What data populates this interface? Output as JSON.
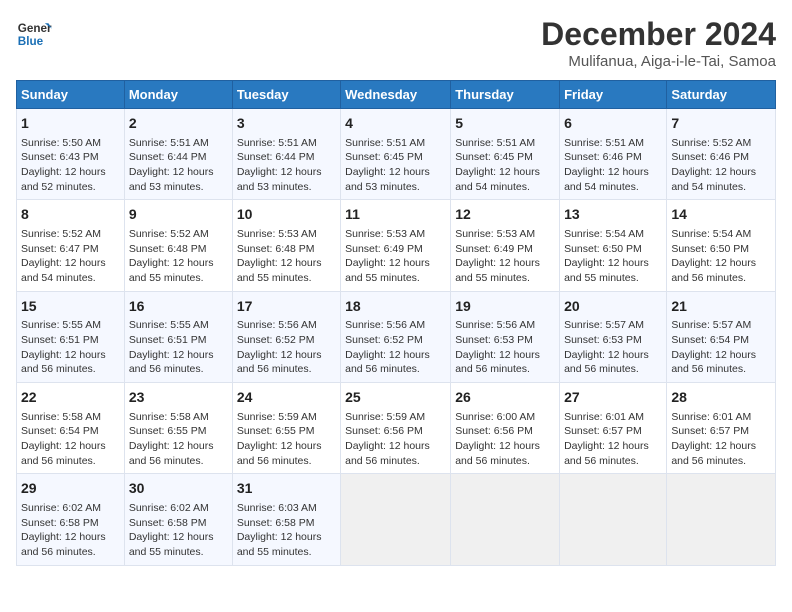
{
  "logo": {
    "line1": "General",
    "line2": "Blue"
  },
  "title": "December 2024",
  "location": "Mulifanua, Aiga-i-le-Tai, Samoa",
  "days_header": [
    "Sunday",
    "Monday",
    "Tuesday",
    "Wednesday",
    "Thursday",
    "Friday",
    "Saturday"
  ],
  "weeks": [
    [
      {
        "day": "1",
        "sunrise": "Sunrise: 5:50 AM",
        "sunset": "Sunset: 6:43 PM",
        "daylight": "Daylight: 12 hours and 52 minutes."
      },
      {
        "day": "2",
        "sunrise": "Sunrise: 5:51 AM",
        "sunset": "Sunset: 6:44 PM",
        "daylight": "Daylight: 12 hours and 53 minutes."
      },
      {
        "day": "3",
        "sunrise": "Sunrise: 5:51 AM",
        "sunset": "Sunset: 6:44 PM",
        "daylight": "Daylight: 12 hours and 53 minutes."
      },
      {
        "day": "4",
        "sunrise": "Sunrise: 5:51 AM",
        "sunset": "Sunset: 6:45 PM",
        "daylight": "Daylight: 12 hours and 53 minutes."
      },
      {
        "day": "5",
        "sunrise": "Sunrise: 5:51 AM",
        "sunset": "Sunset: 6:45 PM",
        "daylight": "Daylight: 12 hours and 54 minutes."
      },
      {
        "day": "6",
        "sunrise": "Sunrise: 5:51 AM",
        "sunset": "Sunset: 6:46 PM",
        "daylight": "Daylight: 12 hours and 54 minutes."
      },
      {
        "day": "7",
        "sunrise": "Sunrise: 5:52 AM",
        "sunset": "Sunset: 6:46 PM",
        "daylight": "Daylight: 12 hours and 54 minutes."
      }
    ],
    [
      {
        "day": "8",
        "sunrise": "Sunrise: 5:52 AM",
        "sunset": "Sunset: 6:47 PM",
        "daylight": "Daylight: 12 hours and 54 minutes."
      },
      {
        "day": "9",
        "sunrise": "Sunrise: 5:52 AM",
        "sunset": "Sunset: 6:48 PM",
        "daylight": "Daylight: 12 hours and 55 minutes."
      },
      {
        "day": "10",
        "sunrise": "Sunrise: 5:53 AM",
        "sunset": "Sunset: 6:48 PM",
        "daylight": "Daylight: 12 hours and 55 minutes."
      },
      {
        "day": "11",
        "sunrise": "Sunrise: 5:53 AM",
        "sunset": "Sunset: 6:49 PM",
        "daylight": "Daylight: 12 hours and 55 minutes."
      },
      {
        "day": "12",
        "sunrise": "Sunrise: 5:53 AM",
        "sunset": "Sunset: 6:49 PM",
        "daylight": "Daylight: 12 hours and 55 minutes."
      },
      {
        "day": "13",
        "sunrise": "Sunrise: 5:54 AM",
        "sunset": "Sunset: 6:50 PM",
        "daylight": "Daylight: 12 hours and 55 minutes."
      },
      {
        "day": "14",
        "sunrise": "Sunrise: 5:54 AM",
        "sunset": "Sunset: 6:50 PM",
        "daylight": "Daylight: 12 hours and 56 minutes."
      }
    ],
    [
      {
        "day": "15",
        "sunrise": "Sunrise: 5:55 AM",
        "sunset": "Sunset: 6:51 PM",
        "daylight": "Daylight: 12 hours and 56 minutes."
      },
      {
        "day": "16",
        "sunrise": "Sunrise: 5:55 AM",
        "sunset": "Sunset: 6:51 PM",
        "daylight": "Daylight: 12 hours and 56 minutes."
      },
      {
        "day": "17",
        "sunrise": "Sunrise: 5:56 AM",
        "sunset": "Sunset: 6:52 PM",
        "daylight": "Daylight: 12 hours and 56 minutes."
      },
      {
        "day": "18",
        "sunrise": "Sunrise: 5:56 AM",
        "sunset": "Sunset: 6:52 PM",
        "daylight": "Daylight: 12 hours and 56 minutes."
      },
      {
        "day": "19",
        "sunrise": "Sunrise: 5:56 AM",
        "sunset": "Sunset: 6:53 PM",
        "daylight": "Daylight: 12 hours and 56 minutes."
      },
      {
        "day": "20",
        "sunrise": "Sunrise: 5:57 AM",
        "sunset": "Sunset: 6:53 PM",
        "daylight": "Daylight: 12 hours and 56 minutes."
      },
      {
        "day": "21",
        "sunrise": "Sunrise: 5:57 AM",
        "sunset": "Sunset: 6:54 PM",
        "daylight": "Daylight: 12 hours and 56 minutes."
      }
    ],
    [
      {
        "day": "22",
        "sunrise": "Sunrise: 5:58 AM",
        "sunset": "Sunset: 6:54 PM",
        "daylight": "Daylight: 12 hours and 56 minutes."
      },
      {
        "day": "23",
        "sunrise": "Sunrise: 5:58 AM",
        "sunset": "Sunset: 6:55 PM",
        "daylight": "Daylight: 12 hours and 56 minutes."
      },
      {
        "day": "24",
        "sunrise": "Sunrise: 5:59 AM",
        "sunset": "Sunset: 6:55 PM",
        "daylight": "Daylight: 12 hours and 56 minutes."
      },
      {
        "day": "25",
        "sunrise": "Sunrise: 5:59 AM",
        "sunset": "Sunset: 6:56 PM",
        "daylight": "Daylight: 12 hours and 56 minutes."
      },
      {
        "day": "26",
        "sunrise": "Sunrise: 6:00 AM",
        "sunset": "Sunset: 6:56 PM",
        "daylight": "Daylight: 12 hours and 56 minutes."
      },
      {
        "day": "27",
        "sunrise": "Sunrise: 6:01 AM",
        "sunset": "Sunset: 6:57 PM",
        "daylight": "Daylight: 12 hours and 56 minutes."
      },
      {
        "day": "28",
        "sunrise": "Sunrise: 6:01 AM",
        "sunset": "Sunset: 6:57 PM",
        "daylight": "Daylight: 12 hours and 56 minutes."
      }
    ],
    [
      {
        "day": "29",
        "sunrise": "Sunrise: 6:02 AM",
        "sunset": "Sunset: 6:58 PM",
        "daylight": "Daylight: 12 hours and 56 minutes."
      },
      {
        "day": "30",
        "sunrise": "Sunrise: 6:02 AM",
        "sunset": "Sunset: 6:58 PM",
        "daylight": "Daylight: 12 hours and 55 minutes."
      },
      {
        "day": "31",
        "sunrise": "Sunrise: 6:03 AM",
        "sunset": "Sunset: 6:58 PM",
        "daylight": "Daylight: 12 hours and 55 minutes."
      },
      null,
      null,
      null,
      null
    ]
  ]
}
